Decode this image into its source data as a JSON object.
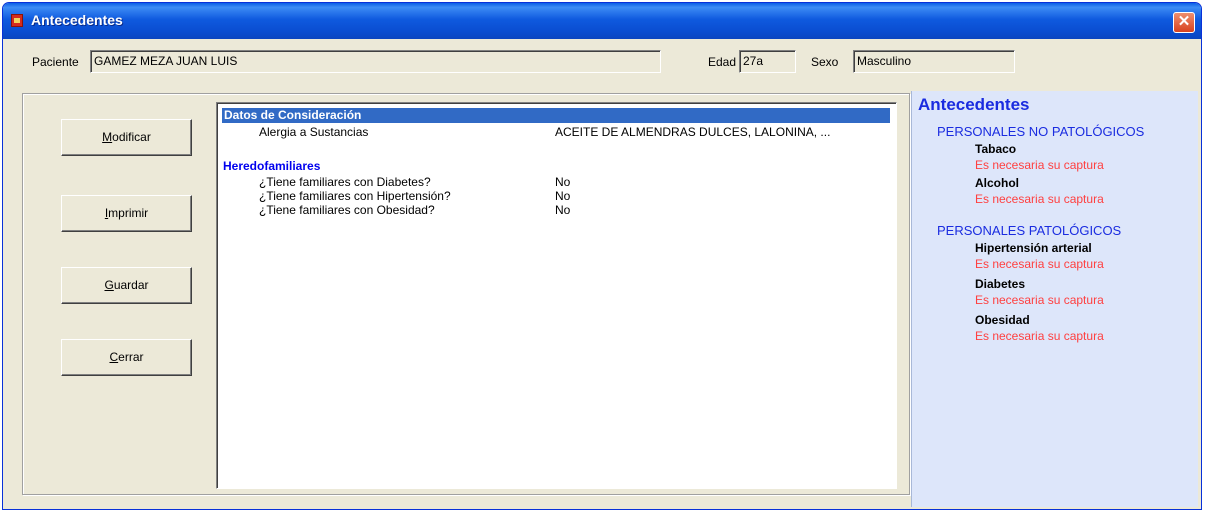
{
  "window": {
    "title": "Antecedentes",
    "close_symbol": "✕"
  },
  "patient": {
    "label": "Paciente",
    "name": "GAMEZ MEZA JUAN LUIS",
    "age_label": "Edad",
    "age": "27a",
    "sex_label": "Sexo",
    "sex": "Masculino"
  },
  "buttons": {
    "modificar": {
      "mnemonic": "M",
      "rest": "odificar"
    },
    "imprimir": {
      "mnemonic": "I",
      "rest": "mprimir"
    },
    "guardar": {
      "mnemonic": "G",
      "rest": "uardar"
    },
    "cerrar": {
      "mnemonic": "C",
      "rest": "errar"
    }
  },
  "list": {
    "header": "Datos de Consideración",
    "consideration_rows": [
      {
        "label": "Alergia a Sustancias",
        "value": "ACEITE DE ALMENDRAS DULCES, LALONINA, ..."
      }
    ],
    "section_title": "Heredofamiliares",
    "hereditary_rows": [
      {
        "label": "¿Tiene familiares con Diabetes?",
        "value": "No"
      },
      {
        "label": "¿Tiene familiares con Hipertensión?",
        "value": "No"
      },
      {
        "label": "¿Tiene familiares con Obesidad?",
        "value": "No"
      }
    ]
  },
  "side": {
    "title": "Antecedentes",
    "cat1": "PERSONALES NO PATOLÓGICOS",
    "tabaco": "Tabaco",
    "alcohol": "Alcohol",
    "cat2": "PERSONALES PATOLÓGICOS",
    "hipertension": "Hipertensión arterial",
    "diabetes": "Diabetes",
    "obesidad": "Obesidad",
    "warning": "Es necesaria su captura"
  },
  "colors": {
    "title_bar": "#0a4dd0",
    "selection": "#316ac5",
    "section": "#0000ee",
    "warning": "#ff4040",
    "side_bg": "#dde6fa"
  }
}
